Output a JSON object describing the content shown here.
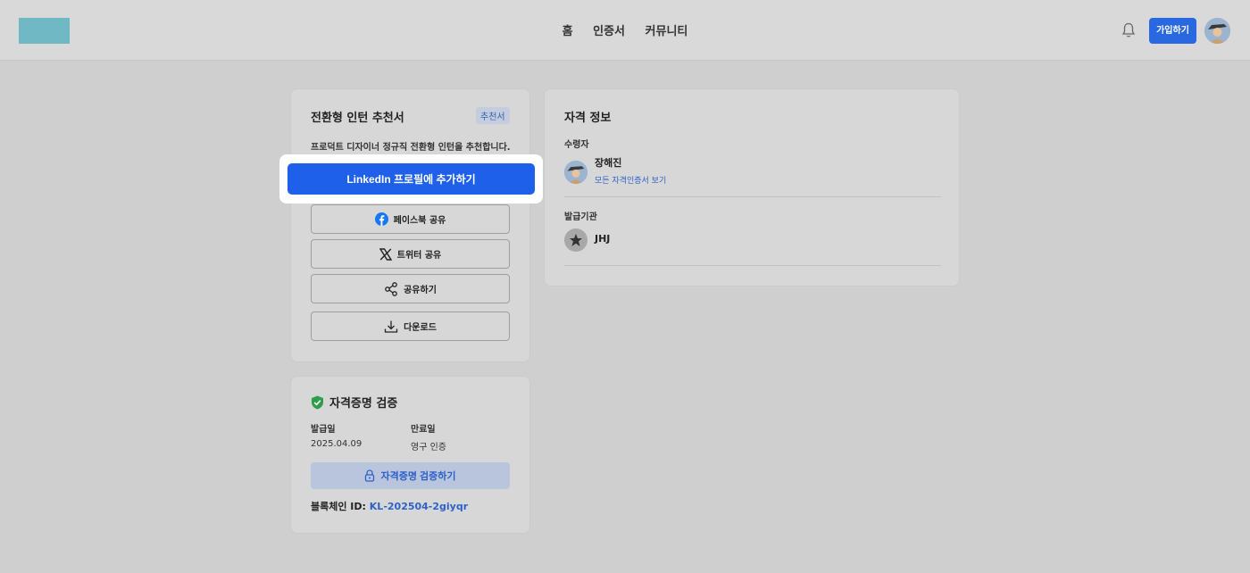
{
  "header": {
    "nav": [
      "홈",
      "인증서",
      "커뮤니티"
    ],
    "signup_label": "가입하기",
    "bell_icon": "bell-icon",
    "avatar": "user-avatar"
  },
  "recommendation": {
    "title": "전환형 인턴 추천서",
    "badge": "추천서",
    "description": "프로덕트 디자이너 정규직 전환형 인턴을 추천합니다.",
    "linkedin_label": "LinkedIn 프로필에 추가하기",
    "facebook_label": "페이스북 공유",
    "twitter_label": "트위터 공유",
    "share_label": "공유하기",
    "download_label": "다운로드"
  },
  "verification": {
    "title": "자격증명 검증",
    "issue_date_label": "발급일",
    "issue_date": "2025.04.09",
    "expiry_label": "만료일",
    "expiry": "영구 인증",
    "verify_label": "자격증명 검증하기",
    "chain_label": "블록체인 ID:",
    "chain_id": "KL-202504-2giyqr"
  },
  "info": {
    "title": "자격 정보",
    "recipient_label": "수령자",
    "recipient_name": "장해진",
    "recipient_link": "모든 자격인증서 보기",
    "issuer_label": "발급기관",
    "issuer_name": "JHJ"
  },
  "colors": {
    "primary": "#1f60eb",
    "link": "#2d62c8",
    "verify_check": "#2e9e4b",
    "facebook": "#1877f2"
  }
}
